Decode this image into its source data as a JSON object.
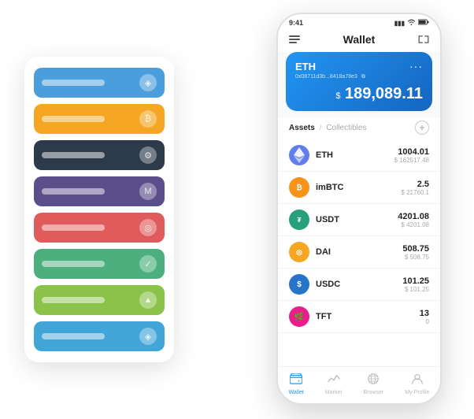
{
  "app": {
    "title": "Wallet"
  },
  "statusBar": {
    "time": "9:41",
    "signal": "▮▮▮",
    "wifi": "WiFi",
    "battery": "🔋"
  },
  "header": {
    "title": "Wallet",
    "menuIcon": "☰",
    "expandIcon": "⇔"
  },
  "ethCard": {
    "label": "ETH",
    "address": "0x08711d3b...8418a78e3",
    "copyIcon": "⧉",
    "moreIcon": "...",
    "balancePrefix": "$",
    "balance": "189,089.11"
  },
  "assetsTabs": {
    "active": "Assets",
    "divider": "/",
    "inactive": "Collectibles"
  },
  "assets": [
    {
      "name": "ETH",
      "amount": "1004.01",
      "usd": "$ 162517.48",
      "icon": "◈",
      "color": "eth-coin"
    },
    {
      "name": "imBTC",
      "amount": "2.5",
      "usd": "$ 21760.1",
      "icon": "₿",
      "color": "imbtc-coin"
    },
    {
      "name": "USDT",
      "amount": "4201.08",
      "usd": "$ 4201.08",
      "icon": "₮",
      "color": "usdt-coin"
    },
    {
      "name": "DAI",
      "amount": "508.75",
      "usd": "$ 508.75",
      "icon": "◎",
      "color": "dai-coin"
    },
    {
      "name": "USDC",
      "amount": "101.25",
      "usd": "$ 101.25",
      "icon": "©",
      "color": "usdc-coin"
    },
    {
      "name": "TFT",
      "amount": "13",
      "usd": "0",
      "icon": "🌿",
      "color": "tft-coin"
    }
  ],
  "bottomNav": [
    {
      "id": "wallet",
      "label": "Wallet",
      "icon": "◎",
      "active": true
    },
    {
      "id": "market",
      "label": "Market",
      "icon": "↗",
      "active": false
    },
    {
      "id": "browser",
      "label": "Browser",
      "icon": "⊙",
      "active": false
    },
    {
      "id": "profile",
      "label": "My Profile",
      "icon": "👤",
      "active": false
    }
  ],
  "cardStack": [
    {
      "color": "stack-blue"
    },
    {
      "color": "stack-orange"
    },
    {
      "color": "stack-dark"
    },
    {
      "color": "stack-purple"
    },
    {
      "color": "stack-red"
    },
    {
      "color": "stack-green"
    },
    {
      "color": "stack-lightgreen"
    },
    {
      "color": "stack-skyblue"
    }
  ]
}
